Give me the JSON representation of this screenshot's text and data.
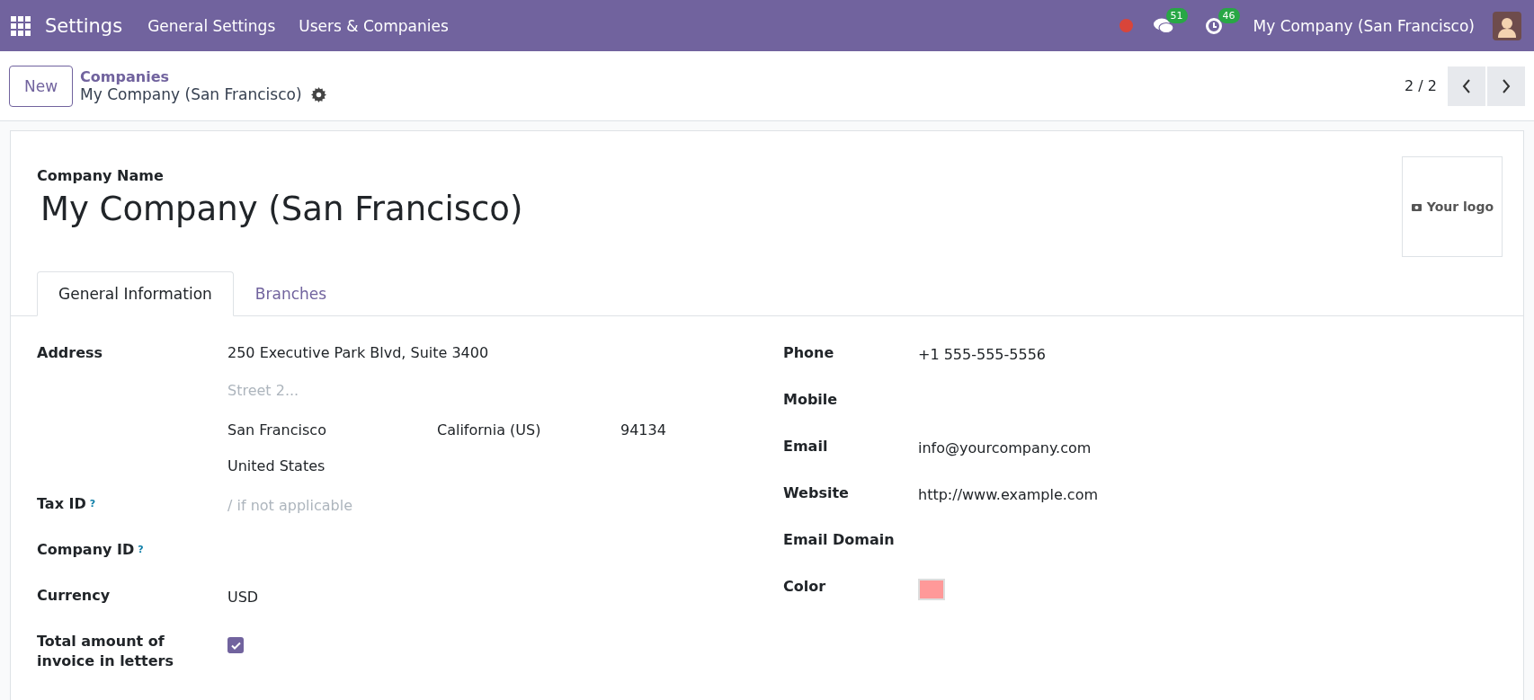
{
  "navbar": {
    "app": "Settings",
    "menu": [
      "General Settings",
      "Users & Companies"
    ],
    "messages_count": "51",
    "activities_count": "46",
    "company": "My Company (San Francisco)"
  },
  "control_panel": {
    "new_button": "New",
    "breadcrumb": "Companies",
    "record": "My Company (San Francisco)",
    "pager": "2 / 2"
  },
  "form": {
    "name_label": "Company Name",
    "name": "My Company (San Francisco)",
    "logo_label": "Your logo",
    "tabs": [
      {
        "label": "General Information",
        "selected": true
      },
      {
        "label": "Branches",
        "selected": false
      }
    ],
    "address": {
      "label": "Address",
      "street": "250 Executive Park Blvd, Suite 3400",
      "street2_placeholder": "Street 2...",
      "city": "San Francisco",
      "state": "California (US)",
      "zip": "94134",
      "country": "United States"
    },
    "left_fields": [
      {
        "kind": "text",
        "label": "Tax ID",
        "help": "?",
        "placeholder": "/ if not applicable"
      },
      {
        "kind": "text",
        "label": "Company ID",
        "help": "?"
      },
      {
        "kind": "text",
        "label": "Currency",
        "value": "USD"
      },
      {
        "kind": "checkbox",
        "label": "Total amount of invoice in letters",
        "checked": true
      }
    ],
    "right_fields": [
      {
        "kind": "text",
        "label": "Phone",
        "value": "+1 555-555-5556"
      },
      {
        "kind": "text",
        "label": "Mobile"
      },
      {
        "kind": "text",
        "label": "Email",
        "value": "info@yourcompany.com"
      },
      {
        "kind": "text",
        "label": "Website",
        "value": "http://www.example.com"
      },
      {
        "kind": "text",
        "label": "Email Domain"
      },
      {
        "kind": "color",
        "label": "Color",
        "color": "#ff9999"
      }
    ]
  }
}
